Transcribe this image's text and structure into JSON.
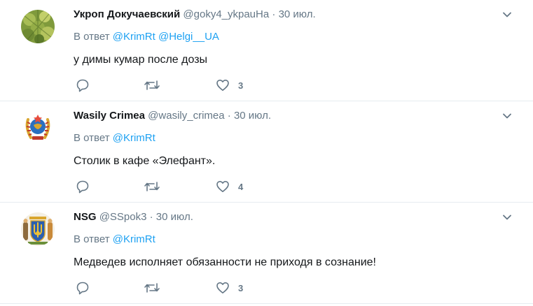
{
  "tweets": [
    {
      "name": "Укроп Докучаевский",
      "handle": "@goky4_ykpauHa",
      "dot": "·",
      "time": "30 июл.",
      "replying_prefix": "В ответ",
      "mentions": [
        "@KrimRt",
        "@Helgi__UA"
      ],
      "text": "у димы кумар после дозы",
      "likes": "3",
      "avatar_icon": "dill-plant-avatar"
    },
    {
      "name": "Wasily Crimea",
      "handle": "@wasily_crimea",
      "dot": "·",
      "time": "30 июл.",
      "replying_prefix": "В ответ",
      "mentions": [
        "@KrimRt"
      ],
      "text": "Столик в кафе «Элефант».",
      "likes": "4",
      "avatar_icon": "soviet-emblem-avatar"
    },
    {
      "name": "NSG",
      "handle": "@SSpok3",
      "dot": "·",
      "time": "30 июл.",
      "replying_prefix": "В ответ",
      "mentions": [
        "@KrimRt"
      ],
      "text": "Медведев исполняет обязанности не приходя в сознание!",
      "likes": "3",
      "avatar_icon": "ukraine-coat-of-arms-avatar"
    }
  ],
  "icons": {
    "reply": "reply-icon",
    "retweet": "retweet-icon",
    "like": "heart-icon",
    "menu": "chevron-down-icon"
  },
  "colors": {
    "link": "#1da1f2",
    "secondary": "#657786",
    "primary_text": "#14171a",
    "divider": "#e6ecf0"
  }
}
